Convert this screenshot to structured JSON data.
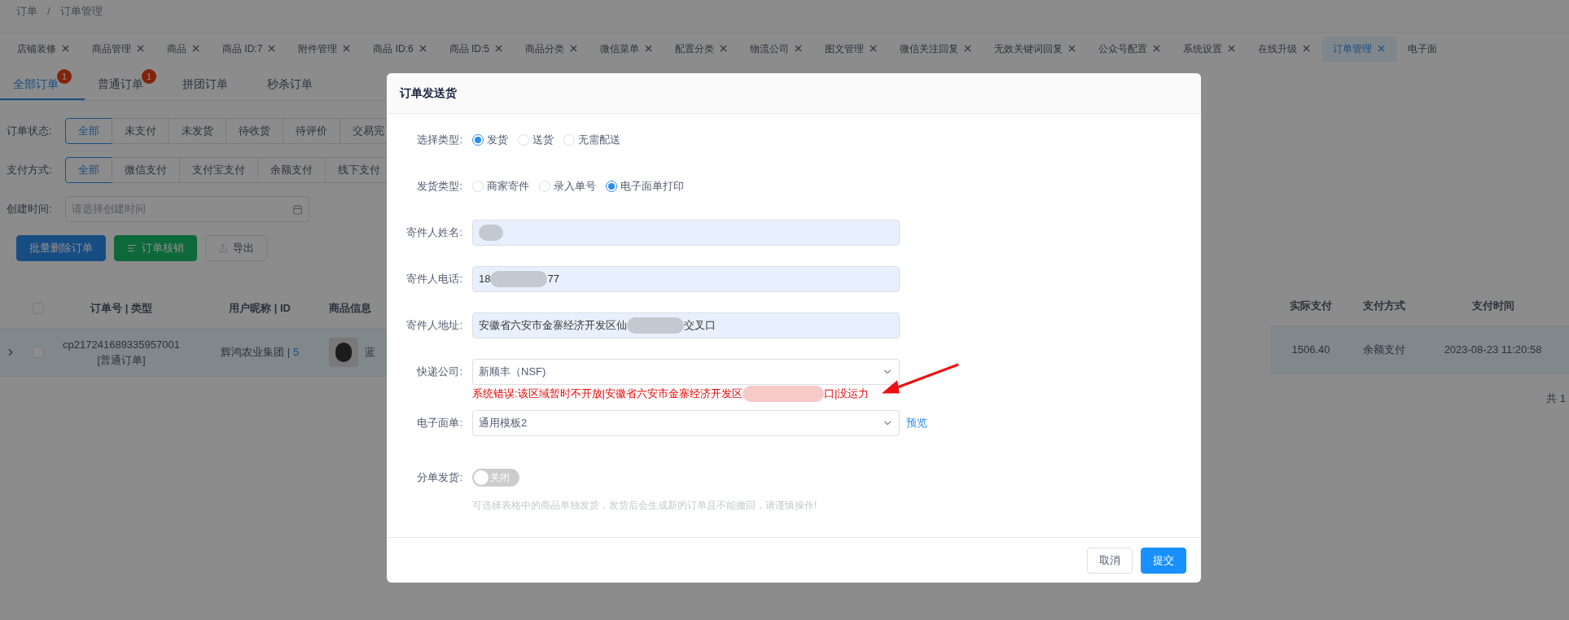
{
  "breadcrumb": {
    "items": [
      "订单",
      "订单管理"
    ],
    "separator": "/"
  },
  "page_tabs": [
    {
      "label": "店铺装修",
      "selected": false,
      "closable": true
    },
    {
      "label": "商品管理",
      "selected": false,
      "closable": true
    },
    {
      "label": "商品",
      "selected": false,
      "closable": true
    },
    {
      "label": "商品 ID:7",
      "selected": false,
      "closable": true
    },
    {
      "label": "附件管理",
      "selected": false,
      "closable": true
    },
    {
      "label": "商品 ID:6",
      "selected": false,
      "closable": true
    },
    {
      "label": "商品 ID:5",
      "selected": false,
      "closable": true
    },
    {
      "label": "商品分类",
      "selected": false,
      "closable": true
    },
    {
      "label": "微信菜单",
      "selected": false,
      "closable": true
    },
    {
      "label": "配置分类",
      "selected": false,
      "closable": true
    },
    {
      "label": "物流公司",
      "selected": false,
      "closable": true
    },
    {
      "label": "图文管理",
      "selected": false,
      "closable": true
    },
    {
      "label": "微信关注回复",
      "selected": false,
      "closable": true
    },
    {
      "label": "无效关键词回复",
      "selected": false,
      "closable": true
    },
    {
      "label": "公众号配置",
      "selected": false,
      "closable": true
    },
    {
      "label": "系统设置",
      "selected": false,
      "closable": true
    },
    {
      "label": "在线升级",
      "selected": false,
      "closable": true
    },
    {
      "label": "订单管理",
      "selected": true,
      "closable": true
    },
    {
      "label": "电子面",
      "selected": false,
      "closable": false
    }
  ],
  "order_tabs": [
    {
      "label": "全部订单",
      "badge": "1",
      "selected": true
    },
    {
      "label": "普通订单",
      "badge": "1",
      "selected": false
    },
    {
      "label": "拼团订单",
      "selected": false
    },
    {
      "label": "秒杀订单",
      "selected": false
    }
  ],
  "filters": [
    {
      "kind": "segmented",
      "label": "订单状态:",
      "options": [
        {
          "label": "全部",
          "selected": true
        },
        {
          "label": "未支付",
          "selected": false
        },
        {
          "label": "未发货",
          "selected": false
        },
        {
          "label": "待收货",
          "selected": false
        },
        {
          "label": "待评价",
          "selected": false
        },
        {
          "label": "交易完",
          "selected": false
        }
      ]
    },
    {
      "kind": "segmented",
      "label": "支付方式:",
      "options": [
        {
          "label": "全部",
          "selected": true
        },
        {
          "label": "微信支付",
          "selected": false
        },
        {
          "label": "支付宝支付",
          "selected": false
        },
        {
          "label": "余额支付",
          "selected": false
        },
        {
          "label": "线下支付",
          "selected": false
        }
      ]
    },
    {
      "kind": "date",
      "label": "创建时间:",
      "placeholder": "请选择创建时间"
    }
  ],
  "actions": [
    {
      "kind": "primary",
      "label": "批量删除订单"
    },
    {
      "kind": "success",
      "label": "订单核销"
    },
    {
      "kind": "default",
      "label": "导出"
    }
  ],
  "table": {
    "all_checked": false,
    "columns_left": [
      "订单号 | 类型",
      "用户昵称 | ID",
      "商品信息"
    ],
    "columns_right": [
      "实际支付",
      "支付方式",
      "支付时间"
    ],
    "rows": [
      {
        "expanded": false,
        "checked": false,
        "order_no": "cp217241689335957001",
        "order_type": "[普通订单]",
        "user_name": "辉鸿农业集团",
        "user_separator": "|",
        "user_id": "5",
        "product_name": "蓝",
        "paid": "1506.40",
        "pay_method": "余额支付",
        "pay_time": "2023-08-23 11:20:58"
      }
    ]
  },
  "pagination": {
    "total": "共 1"
  },
  "dialog": {
    "title": "订单发送货",
    "fields": [
      {
        "kind": "radio",
        "label": "选择类型:",
        "options": [
          {
            "label": "发货",
            "selected": true
          },
          {
            "label": "送货",
            "selected": false
          },
          {
            "label": "无需配送",
            "selected": false
          }
        ]
      },
      {
        "kind": "radio",
        "label": "发货类型:",
        "options": [
          {
            "label": "商家寄件",
            "selected": false
          },
          {
            "label": "录入单号",
            "selected": false
          },
          {
            "label": "电子面单打印",
            "selected": true
          }
        ]
      },
      {
        "kind": "input",
        "label": "寄件人姓名:",
        "redacted": true
      },
      {
        "kind": "input",
        "label": "寄件人电话:",
        "value_before": "18",
        "value_after": "77",
        "redacted": true
      },
      {
        "kind": "input",
        "label": "寄件人地址:",
        "value_before": "安徽省六安市金寨经济开发区仙",
        "value_after": "交叉口",
        "redacted": true
      },
      {
        "kind": "select",
        "label": "快递公司:",
        "value": "新顺丰（NSF)",
        "error_before": "系统错误:该区域暂时不开放|安徽省六安市金寨经济开发区",
        "error_after": "口|没运力"
      },
      {
        "kind": "select",
        "label": "电子面单:",
        "value": "通用模板2",
        "link": "预览"
      },
      {
        "kind": "switch",
        "label": "分单发货:",
        "on": false,
        "switch_text": "关闭",
        "hint": "可选择表格中的商品单独发货，发货后会生成新的订单且不能撤回，请谨慎操作!"
      }
    ],
    "buttons": [
      {
        "kind": "default",
        "label": "取消"
      },
      {
        "kind": "primary",
        "label": "提交"
      }
    ]
  }
}
